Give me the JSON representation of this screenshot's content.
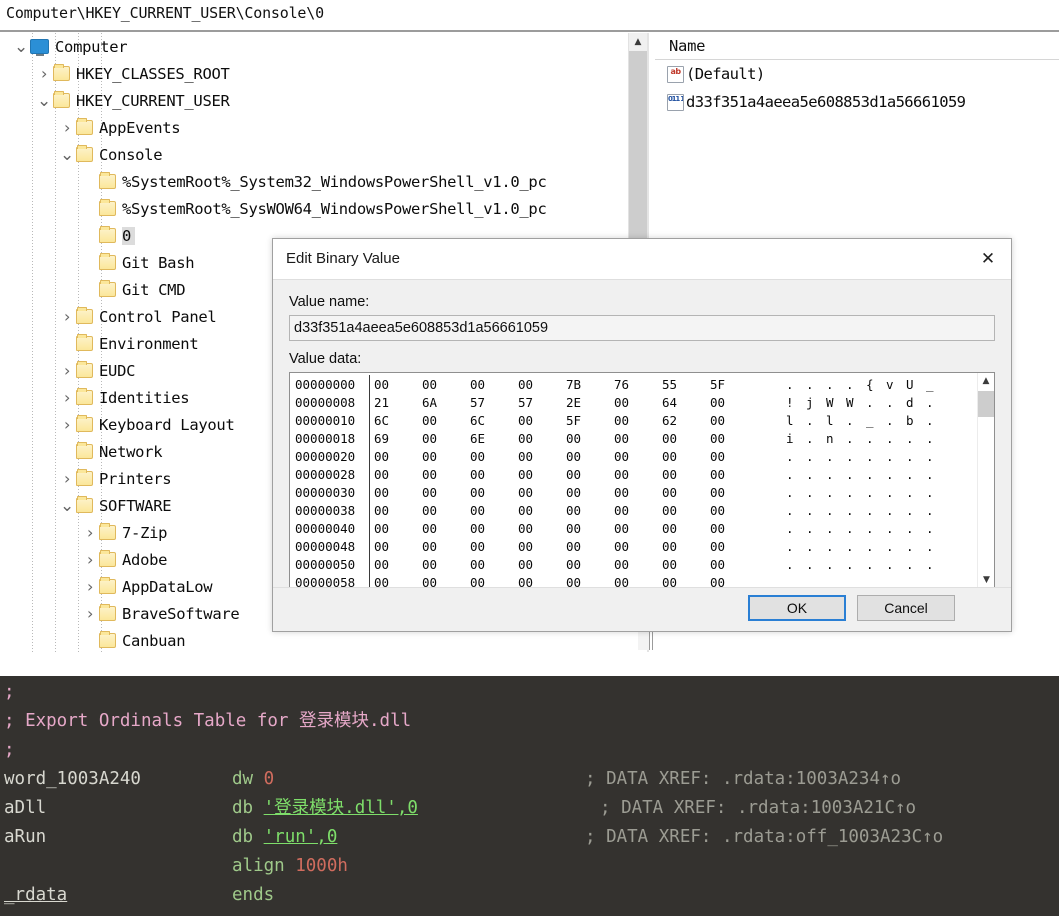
{
  "regedit": {
    "address_bar": "Computer\\HKEY_CURRENT_USER\\Console\\0",
    "tree": [
      {
        "label": "Computer",
        "depth": 0,
        "chevron": "v",
        "icon": "monitor",
        "selected": false
      },
      {
        "label": "HKEY_CLASSES_ROOT",
        "depth": 1,
        "chevron": ">",
        "icon": "folder",
        "selected": false
      },
      {
        "label": "HKEY_CURRENT_USER",
        "depth": 1,
        "chevron": "v",
        "icon": "folder",
        "selected": false
      },
      {
        "label": "AppEvents",
        "depth": 2,
        "chevron": ">",
        "icon": "folder",
        "selected": false
      },
      {
        "label": "Console",
        "depth": 2,
        "chevron": "v",
        "icon": "folder",
        "selected": false
      },
      {
        "label": "%SystemRoot%_System32_WindowsPowerShell_v1.0_pc",
        "depth": 3,
        "chevron": "",
        "icon": "folder",
        "selected": false
      },
      {
        "label": "%SystemRoot%_SysWOW64_WindowsPowerShell_v1.0_pc",
        "depth": 3,
        "chevron": "",
        "icon": "folder",
        "selected": false
      },
      {
        "label": "0",
        "depth": 3,
        "chevron": "",
        "icon": "folder",
        "selected": true
      },
      {
        "label": "Git Bash",
        "depth": 3,
        "chevron": "",
        "icon": "folder",
        "selected": false
      },
      {
        "label": "Git CMD",
        "depth": 3,
        "chevron": "",
        "icon": "folder",
        "selected": false
      },
      {
        "label": "Control Panel",
        "depth": 2,
        "chevron": ">",
        "icon": "folder",
        "selected": false
      },
      {
        "label": "Environment",
        "depth": 2,
        "chevron": "",
        "icon": "folder",
        "selected": false
      },
      {
        "label": "EUDC",
        "depth": 2,
        "chevron": ">",
        "icon": "folder",
        "selected": false
      },
      {
        "label": "Identities",
        "depth": 2,
        "chevron": ">",
        "icon": "folder",
        "selected": false
      },
      {
        "label": "Keyboard Layout",
        "depth": 2,
        "chevron": ">",
        "icon": "folder",
        "selected": false
      },
      {
        "label": "Network",
        "depth": 2,
        "chevron": "",
        "icon": "folder",
        "selected": false
      },
      {
        "label": "Printers",
        "depth": 2,
        "chevron": ">",
        "icon": "folder",
        "selected": false
      },
      {
        "label": "SOFTWARE",
        "depth": 2,
        "chevron": "v",
        "icon": "folder",
        "selected": false
      },
      {
        "label": "7-Zip",
        "depth": 3,
        "chevron": ">",
        "icon": "folder",
        "selected": false
      },
      {
        "label": "Adobe",
        "depth": 3,
        "chevron": ">",
        "icon": "folder",
        "selected": false
      },
      {
        "label": "AppDataLow",
        "depth": 3,
        "chevron": ">",
        "icon": "folder",
        "selected": false
      },
      {
        "label": "BraveSoftware",
        "depth": 3,
        "chevron": ">",
        "icon": "folder",
        "selected": false
      },
      {
        "label": "Canbuan",
        "depth": 3,
        "chevron": "",
        "icon": "folder",
        "selected": false
      }
    ],
    "values_header": "Name",
    "values": [
      {
        "name": "(Default)",
        "icon": "ab",
        "icon_text": "ab"
      },
      {
        "name": "d33f351a4aeea5e608853d1a56661059",
        "icon": "bin",
        "icon_text": "011 110"
      }
    ]
  },
  "dialog": {
    "title": "Edit Binary Value",
    "close_icon": "✕",
    "value_name_label": "Value name:",
    "value_name": "d33f351a4aeea5e608853d1a56661059",
    "value_data_label": "Value data:",
    "ok_label": "OK",
    "cancel_label": "Cancel",
    "hex_lines": [
      {
        "offset": "00000000",
        "bytes": [
          "00",
          "00",
          "00",
          "00",
          "7B",
          "76",
          "55",
          "5F"
        ],
        "ascii": [
          ".",
          ".",
          ".",
          ".",
          "{",
          "v",
          "U",
          "_"
        ]
      },
      {
        "offset": "00000008",
        "bytes": [
          "21",
          "6A",
          "57",
          "57",
          "2E",
          "00",
          "64",
          "00"
        ],
        "ascii": [
          "!",
          "j",
          "W",
          "W",
          ".",
          ".",
          "d",
          "."
        ]
      },
      {
        "offset": "00000010",
        "bytes": [
          "6C",
          "00",
          "6C",
          "00",
          "5F",
          "00",
          "62",
          "00"
        ],
        "ascii": [
          "l",
          ".",
          "l",
          ".",
          "_",
          ".",
          "b",
          "."
        ]
      },
      {
        "offset": "00000018",
        "bytes": [
          "69",
          "00",
          "6E",
          "00",
          "00",
          "00",
          "00",
          "00"
        ],
        "ascii": [
          "i",
          ".",
          "n",
          ".",
          ".",
          ".",
          ".",
          "."
        ]
      },
      {
        "offset": "00000020",
        "bytes": [
          "00",
          "00",
          "00",
          "00",
          "00",
          "00",
          "00",
          "00"
        ],
        "ascii": [
          ".",
          ".",
          ".",
          ".",
          ".",
          ".",
          ".",
          "."
        ]
      },
      {
        "offset": "00000028",
        "bytes": [
          "00",
          "00",
          "00",
          "00",
          "00",
          "00",
          "00",
          "00"
        ],
        "ascii": [
          ".",
          ".",
          ".",
          ".",
          ".",
          ".",
          ".",
          "."
        ]
      },
      {
        "offset": "00000030",
        "bytes": [
          "00",
          "00",
          "00",
          "00",
          "00",
          "00",
          "00",
          "00"
        ],
        "ascii": [
          ".",
          ".",
          ".",
          ".",
          ".",
          ".",
          ".",
          "."
        ]
      },
      {
        "offset": "00000038",
        "bytes": [
          "00",
          "00",
          "00",
          "00",
          "00",
          "00",
          "00",
          "00"
        ],
        "ascii": [
          ".",
          ".",
          ".",
          ".",
          ".",
          ".",
          ".",
          "."
        ]
      },
      {
        "offset": "00000040",
        "bytes": [
          "00",
          "00",
          "00",
          "00",
          "00",
          "00",
          "00",
          "00"
        ],
        "ascii": [
          ".",
          ".",
          ".",
          ".",
          ".",
          ".",
          ".",
          "."
        ]
      },
      {
        "offset": "00000048",
        "bytes": [
          "00",
          "00",
          "00",
          "00",
          "00",
          "00",
          "00",
          "00"
        ],
        "ascii": [
          ".",
          ".",
          ".",
          ".",
          ".",
          ".",
          ".",
          "."
        ]
      },
      {
        "offset": "00000050",
        "bytes": [
          "00",
          "00",
          "00",
          "00",
          "00",
          "00",
          "00",
          "00"
        ],
        "ascii": [
          ".",
          ".",
          ".",
          ".",
          ".",
          ".",
          ".",
          "."
        ]
      },
      {
        "offset": "00000058",
        "bytes": [
          "00",
          "00",
          "00",
          "00",
          "00",
          "00",
          "00",
          "00"
        ],
        "ascii": [
          "",
          "",
          "",
          "",
          "",
          "",
          "",
          ""
        ]
      }
    ]
  },
  "ida": {
    "lines": [
      {
        "name": ";",
        "name_class": "ida-cmt",
        "instr": "",
        "xref": ""
      },
      {
        "name": "; Export Ordinals Table for 登录模块.dll",
        "name_class": "ida-cmt",
        "instr": "",
        "xref": ""
      },
      {
        "name": ";",
        "name_class": "ida-cmt",
        "instr": "",
        "xref": ""
      },
      {
        "name": "word_1003A240",
        "name_class": "ida-name",
        "mnemonic": "dw",
        "operand": "0",
        "operand_class": "ida-num",
        "xref": "; DATA XREF: .rdata:1003A234↑o",
        "xref_col": "col-xref"
      },
      {
        "name": "aDll",
        "name_class": "ida-name",
        "mnemonic": "db",
        "operand": "'登录模块.dll',0",
        "operand_class": "ida-str",
        "xref": "; DATA XREF: .rdata:1003A21C↑o",
        "xref_col": "col-xref2"
      },
      {
        "name": "aRun",
        "name_class": "ida-name",
        "mnemonic": "db",
        "operand": "'run',0",
        "operand_class": "ida-str",
        "xref": "; DATA XREF: .rdata:off_1003A23C↑o",
        "xref_col": "col-xref"
      },
      {
        "name": "",
        "name_class": "ida-name",
        "mnemonic": "align",
        "operand": "1000h",
        "operand_class": "ida-num",
        "xref": ""
      },
      {
        "name": "_rdata",
        "name_class": "ida-lbl",
        "mnemonic": "ends",
        "operand": "",
        "operand_class": "ida-num",
        "xref": ""
      }
    ]
  }
}
